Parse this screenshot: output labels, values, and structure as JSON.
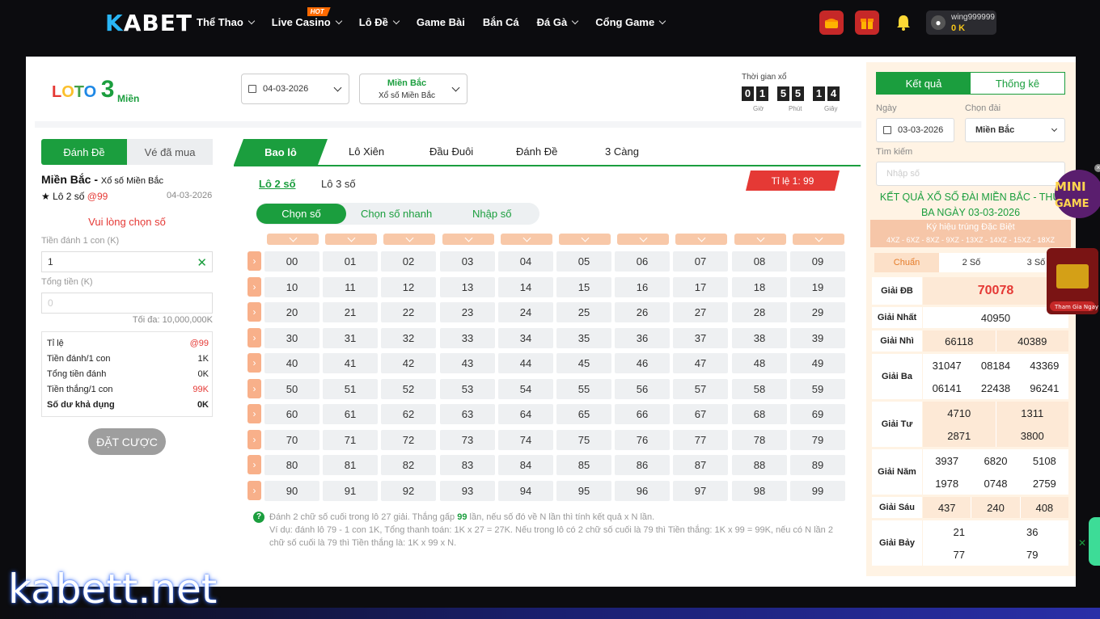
{
  "nav": {
    "logo": "KABET",
    "items": [
      {
        "label": "Thể Thao",
        "chevron": true
      },
      {
        "label": "Live Casino",
        "chevron": true,
        "badge": "HOT"
      },
      {
        "label": "Lô Đề",
        "chevron": true
      },
      {
        "label": "Game Bài",
        "chevron": false
      },
      {
        "label": "Bắn Cá",
        "chevron": false
      },
      {
        "label": "Đá Gà",
        "chevron": true
      },
      {
        "label": "Cổng Game",
        "chevron": true
      }
    ],
    "icons": [
      "treasure-icon",
      "gift-icon",
      "bell-icon",
      "user-icon"
    ],
    "username": "wing999999",
    "balance": "0 K"
  },
  "header": {
    "brand_top": "LOTO",
    "brand_num": "3",
    "brand_sub": "Miền",
    "date": "04-03-2026",
    "region_title": "Miền Bắc",
    "region_sub": "Xổ số Miền Bắc",
    "timer_label": "Thời gian xổ",
    "timer_digits": [
      "0",
      "1",
      "5",
      "5",
      "1",
      "4"
    ],
    "timer_units": [
      "Giờ",
      "Phút",
      "Giây"
    ]
  },
  "left": {
    "tab_active": "Đánh Đề",
    "tab_inactive": "Vé đã mua",
    "title": "Miền Bắc - ",
    "title_small": "Xổ số Miền Bắc",
    "bet_type": "★ Lô 2 số ",
    "bet_rate": "@99",
    "date": "04-03-2026",
    "prompt": "Vui lòng chọn số",
    "per_label": "Tiền đánh 1 con (K)",
    "per_value": "1",
    "total_label": "Tổng tiền (K)",
    "total_placeholder": "0",
    "max_note": "Tối đa: 10,000,000K",
    "summary": [
      {
        "k": "Tỉ lệ",
        "v": "@99",
        "red": true
      },
      {
        "k": "Tiền đánh/1 con",
        "v": "1K",
        "red": false
      },
      {
        "k": "Tổng tiền đánh",
        "v": "0K",
        "red": false
      },
      {
        "k": "Tiền thắng/1 con",
        "v": "99K",
        "red": true
      },
      {
        "k": "Số dư khả dụng",
        "v": "0K",
        "bold": true
      }
    ],
    "bet_button": "ĐẶT CƯỢC"
  },
  "center": {
    "tabs": [
      "Bao lô",
      "Lô Xiên",
      "Đầu Đuôi",
      "Đánh Đề",
      "3 Càng"
    ],
    "subtabs": [
      "Lô 2 số",
      "Lô 3 số"
    ],
    "ratio": "Tỉ lệ 1: 99",
    "modes": [
      "Chọn số",
      "Chọn số nhanh",
      "Nhập số"
    ],
    "help_line1_a": "Đánh 2 chữ số cuối trong lô 27 giải. Thắng gấp ",
    "help_line1_b": "99",
    "help_line1_c": " lần, nếu số đó về N lần thì tính kết quả x N lần.",
    "help_line2": "Ví dụ: đánh lô 79 - 1 con 1K, Tổng thanh toán: 1K x 27 = 27K. Nếu trong lô có 2 chữ số cuối là 79 thì Tiền thắng: 1K x 99 = 99K, nếu có N lần 2 chữ số cuối là 79 thì Tiền thắng là: 1K x 99 x N."
  },
  "right": {
    "tab_active": "Kết quả",
    "tab_inactive": "Thống kê",
    "date_label": "Ngày",
    "date_value": "03-03-2026",
    "region_label": "Chọn đài",
    "region_value": "Miền Bắc",
    "search_label": "Tìm kiếm",
    "search_placeholder": "Nhập số",
    "result_title": "KẾT QUẢ XỔ SỐ ĐÀI MIỀN BẮC - THỨ BA NGÀY 03-03-2026",
    "symbol_label": "Ký hiệu trúng Đặc Biệt",
    "symbol_codes": "4XZ - 6XZ - 8XZ - 9XZ - 13XZ - 14XZ - 15XZ - 18XZ",
    "modes": [
      "Chuẩn",
      "2 Số",
      "3 Số"
    ],
    "prizes": [
      {
        "name": "Giải ĐB",
        "rows": [
          [
            "70078"
          ]
        ],
        "special": true
      },
      {
        "name": "Giải Nhất",
        "rows": [
          [
            "40950"
          ]
        ]
      },
      {
        "name": "Giải Nhì",
        "rows": [
          [
            "66118",
            "40389"
          ]
        ]
      },
      {
        "name": "Giải Ba",
        "rows": [
          [
            "31047",
            "08184",
            "43369"
          ],
          [
            "06141",
            "22438",
            "96241"
          ]
        ]
      },
      {
        "name": "Giải Tư",
        "rows": [
          [
            "4710",
            "1311"
          ],
          [
            "2871",
            "3800"
          ]
        ]
      },
      {
        "name": "Giải Năm",
        "rows": [
          [
            "3937",
            "6820",
            "5108"
          ],
          [
            "1978",
            "0748",
            "2759"
          ]
        ]
      },
      {
        "name": "Giải Sáu",
        "rows": [
          [
            "437",
            "240",
            "408"
          ]
        ]
      },
      {
        "name": "Giải Bảy",
        "rows": [
          [
            "21",
            "36"
          ],
          [
            "77",
            "79"
          ]
        ]
      }
    ]
  },
  "promo": {
    "mini_game": "MINI GAME",
    "promo_button": "Tham Gia Ngay"
  },
  "watermark": "kabett.net"
}
